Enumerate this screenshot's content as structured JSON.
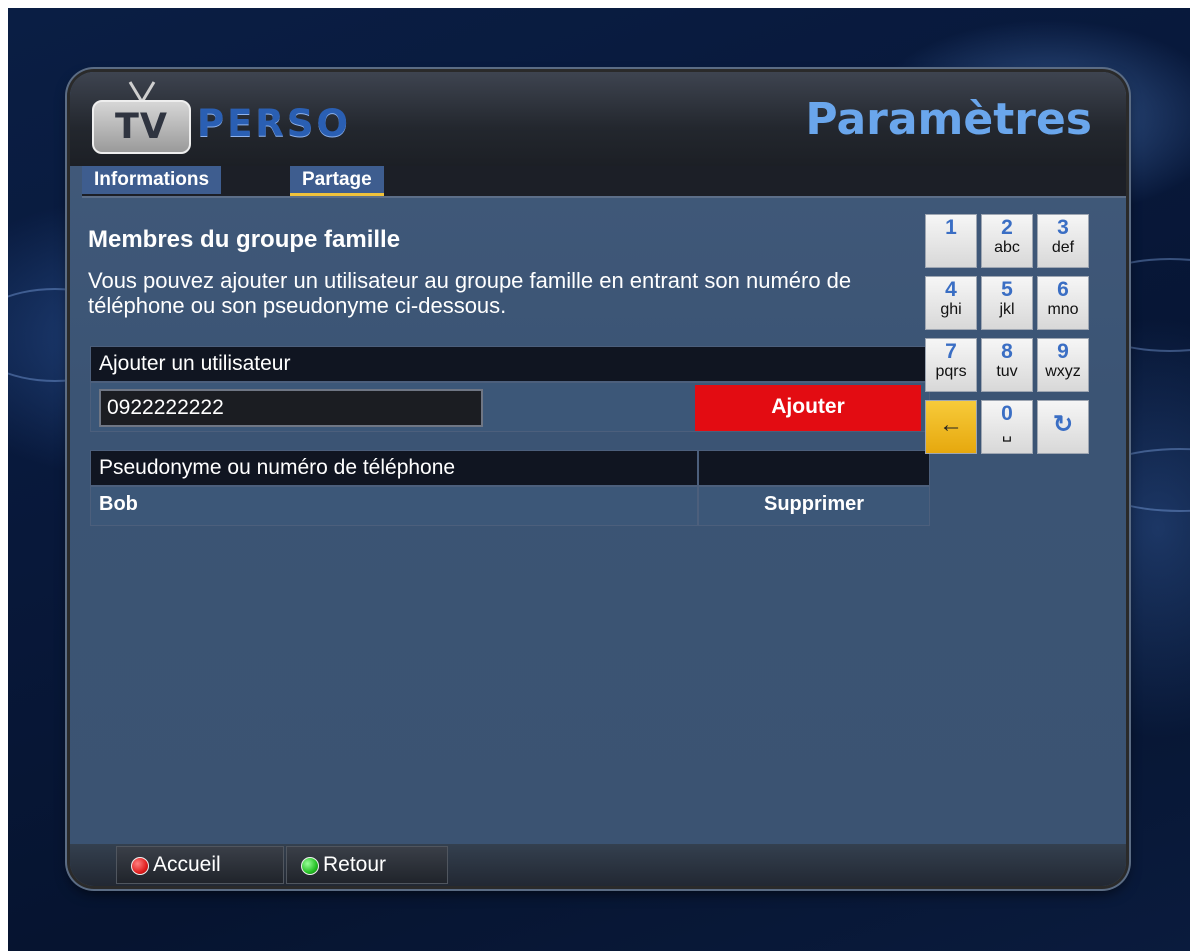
{
  "logo": {
    "tv": "TV",
    "perso": "PERSO"
  },
  "title": "Paramètres",
  "tabs": [
    {
      "label": "Informations",
      "active": false
    },
    {
      "label": "Partage",
      "active": true
    }
  ],
  "section": {
    "heading": "Membres du groupe famille",
    "description": "Vous pouvez ajouter un utilisateur au groupe famille en entrant son numéro de téléphone ou son pseudonyme ci-dessous."
  },
  "add_user": {
    "header": "Ajouter un utilisateur",
    "input_value": "0922222222",
    "button_label": "Ajouter"
  },
  "members_table": {
    "columns": [
      "Pseudonyme ou numéro de téléphone",
      ""
    ],
    "rows": [
      {
        "name": "Bob",
        "action": "Supprimer"
      }
    ]
  },
  "keypad": {
    "keys": [
      {
        "digit": "1",
        "letters": ""
      },
      {
        "digit": "2",
        "letters": "abc"
      },
      {
        "digit": "3",
        "letters": "def"
      },
      {
        "digit": "4",
        "letters": "ghi"
      },
      {
        "digit": "5",
        "letters": "jkl"
      },
      {
        "digit": "6",
        "letters": "mno"
      },
      {
        "digit": "7",
        "letters": "pqrs"
      },
      {
        "digit": "8",
        "letters": "tuv"
      },
      {
        "digit": "9",
        "letters": "wxyz"
      },
      {
        "digit": "←",
        "letters": "",
        "icon": "backspace-arrow-icon"
      },
      {
        "digit": "0",
        "letters": "␣",
        "icon": "space-icon"
      },
      {
        "digit": "↻",
        "letters": "",
        "icon": "refresh-icon"
      }
    ]
  },
  "footer": {
    "buttons": [
      {
        "label": "Accueil",
        "color": "#e02020",
        "icon": "red-button-icon"
      },
      {
        "label": "Retour",
        "color": "#25c025",
        "icon": "green-button-icon"
      }
    ]
  },
  "colors": {
    "accent_blue": "#6aa6ec",
    "add_button": "#e30c12",
    "tab_active_underline": "#f0c23a",
    "panel": "#3b5474"
  }
}
